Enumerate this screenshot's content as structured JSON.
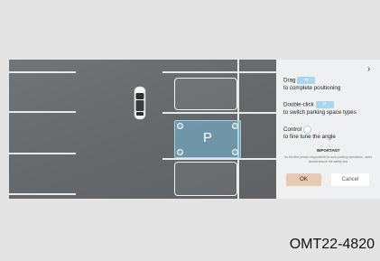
{
  "panel": {
    "close_arrow": "›",
    "drag_label": "Drag",
    "drag_chip": "⇆",
    "drag_desc": "to complete positioning",
    "doubleclick_label": "Double-click",
    "doubleclick_chip": "P",
    "doubleclick_desc": "to switch parking space types",
    "control_label": "Control",
    "control_desc": "to fine tune the angle",
    "important_title": "IMPORTANT",
    "important_text": "As the first person responsible for auto parking operations, users should ensure the safety and",
    "ok_label": "OK",
    "cancel_label": "Cancel"
  },
  "parking": {
    "selected_slot_label": "P"
  },
  "caption": "OMT22-4820",
  "colors": {
    "accent": "#a9d6ec",
    "ok_button": "#e8c9b4"
  }
}
